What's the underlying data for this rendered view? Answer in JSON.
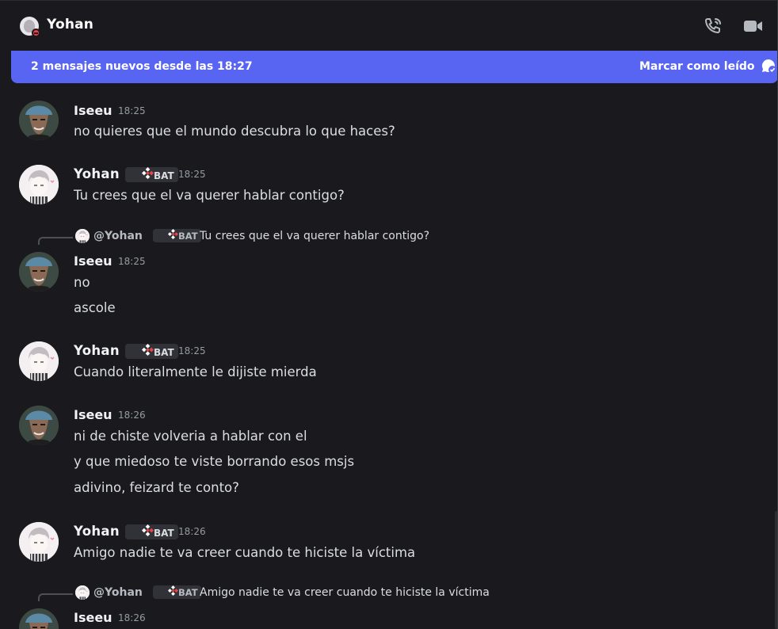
{
  "header": {
    "title": "Yohan",
    "call_icon": "phone-call-icon",
    "video_icon": "video-camera-icon",
    "status": "do-not-disturb"
  },
  "new_messages_bar": {
    "text": "2 mensajes nuevos desde las 18:27",
    "mark_read_label": "Marcar como leído",
    "mark_read_icon": "chat-check-icon",
    "color": "#5865f2"
  },
  "badge_label": "BAT",
  "messages": [
    {
      "author": "Iseeu",
      "time": "18:25",
      "lines": [
        "no quieres que el mundo descubra lo que haces?"
      ]
    },
    {
      "author": "Yohan",
      "time": "18:25",
      "badge": "BAT",
      "lines": [
        "Tu crees que el va querer hablar contigo?"
      ]
    },
    {
      "author": "Iseeu",
      "time": "18:25",
      "reply": {
        "author": "@Yohan",
        "badge": "BAT",
        "text": "Tu crees que el va querer hablar contigo?"
      },
      "lines": [
        "no",
        "ascole"
      ]
    },
    {
      "author": "Yohan",
      "time": "18:25",
      "badge": "BAT",
      "lines": [
        "Cuando literalmente le dijiste mierda"
      ]
    },
    {
      "author": "Iseeu",
      "time": "18:26",
      "lines": [
        "ni de chiste volveria a hablar con el",
        "y que miedoso te viste borrando esos msjs",
        "adivino, feizard te conto?"
      ]
    },
    {
      "author": "Yohan",
      "time": "18:26",
      "badge": "BAT",
      "lines": [
        "Amigo nadie te va creer cuando te hiciste la víctima"
      ]
    },
    {
      "author": "Iseeu",
      "time": "18:26",
      "reply": {
        "author": "@Yohan",
        "badge": "BAT",
        "text": "Amigo nadie te va creer cuando te hiciste la víctima"
      },
      "lines": []
    }
  ],
  "colors": {
    "background": "#1a1a1e",
    "author": "#f2f3f5",
    "text": "#dbdee1",
    "timestamp": "#949ba4",
    "badge_bg": "#313238"
  }
}
